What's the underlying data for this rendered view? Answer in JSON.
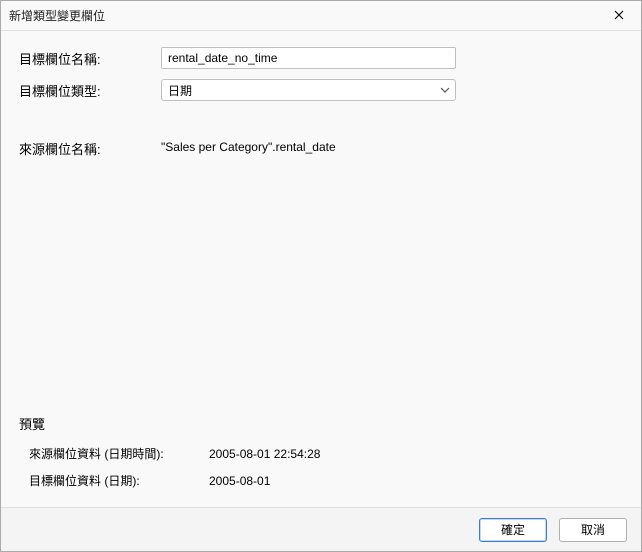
{
  "dialog": {
    "title": "新增類型變更欄位"
  },
  "form": {
    "target_name_label": "目標欄位名稱:",
    "target_name_value": "rental_date_no_time",
    "target_type_label": "目標欄位類型:",
    "target_type_value": "日期",
    "source_name_label": "來源欄位名稱:",
    "source_name_value": "\"Sales per Category\".rental_date"
  },
  "preview": {
    "title": "預覽",
    "source_data_label": "來源欄位資料 (日期時間):",
    "source_data_value": "2005-08-01 22:54:28",
    "target_data_label": "目標欄位資料 (日期):",
    "target_data_value": "2005-08-01"
  },
  "buttons": {
    "ok": "確定",
    "cancel": "取消"
  }
}
